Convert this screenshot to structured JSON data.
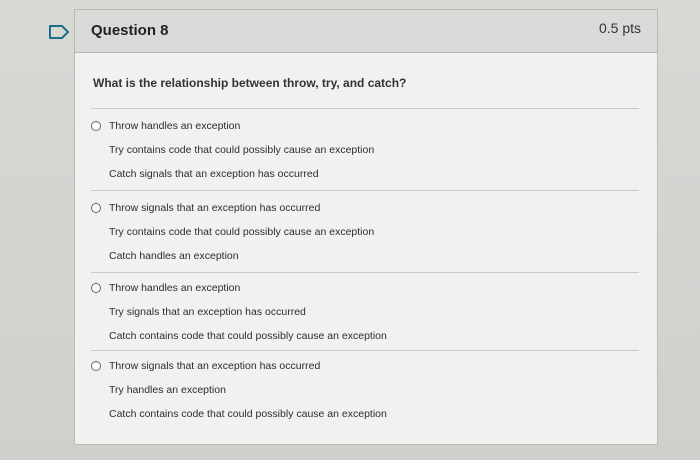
{
  "question": {
    "title": "Question 8",
    "points": "0.5 pts",
    "prompt": "What is the relationship between throw, try, and catch?"
  },
  "answers": [
    {
      "lines": [
        "Throw handles an exception",
        "Try contains code that could possibly cause an exception",
        "Catch signals that an exception has occurred"
      ]
    },
    {
      "lines": [
        "Throw signals that an exception has occurred",
        "Try contains code that could possibly cause an exception",
        "Catch handles an exception"
      ]
    },
    {
      "lines": [
        "Throw handles an exception",
        "Try signals that an exception has occurred",
        "Catch contains code that could possibly cause an exception"
      ]
    },
    {
      "lines": [
        "Throw signals that an exception has occurred",
        "Try handles an exception",
        "Catch contains code that could possibly cause an exception"
      ]
    }
  ],
  "icons": {
    "flag": "bookmark-flag-icon",
    "radio": "radio-button-icon"
  },
  "colors": {
    "flag": "#1a6f8a",
    "header_bg": "#d9dbd8",
    "card_bg": "#f1f1ef"
  }
}
